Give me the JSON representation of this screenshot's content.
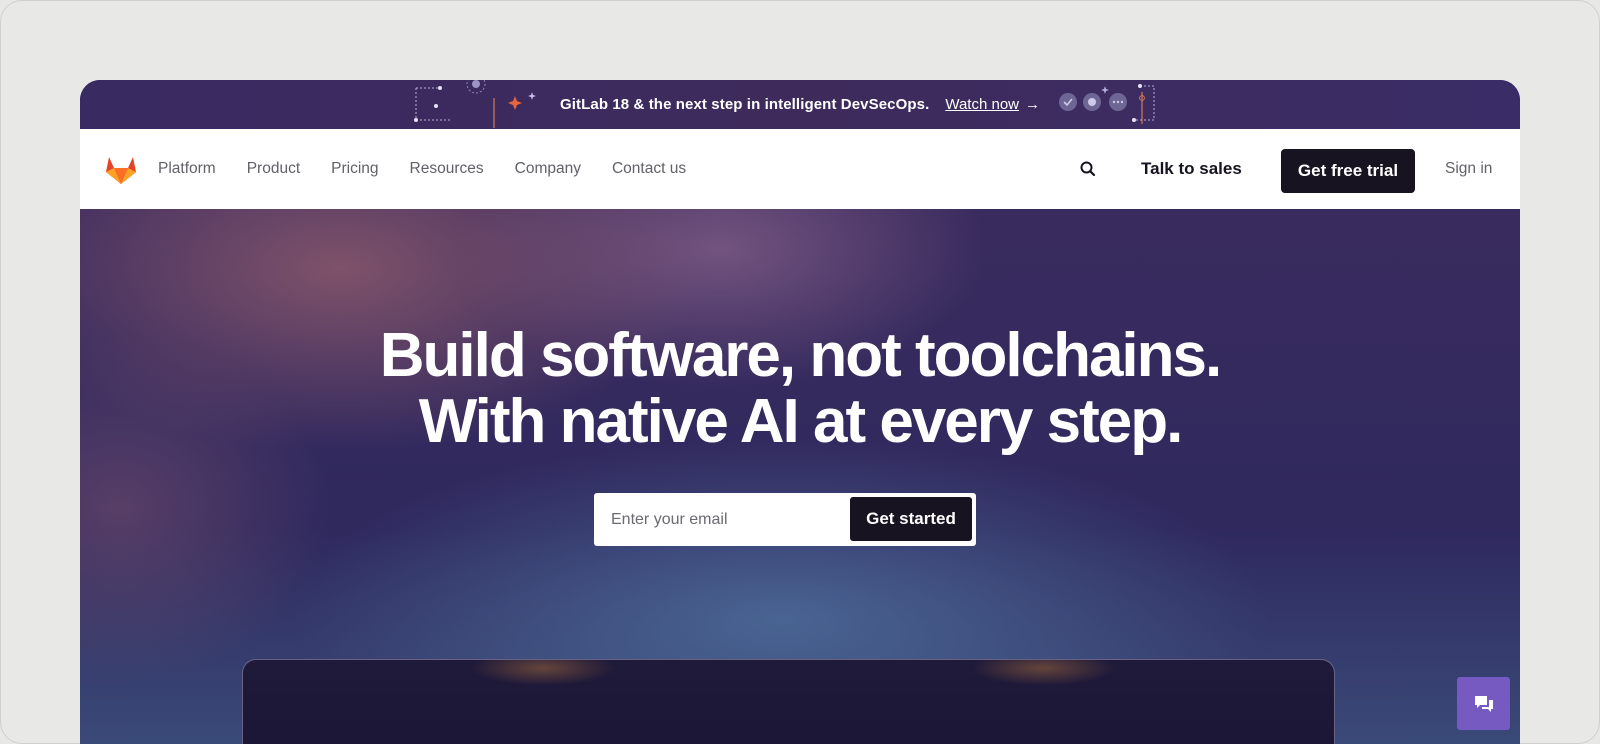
{
  "banner": {
    "text": "GitLab 18 & the next step in intelligent DevSecOps.",
    "link_label": "Watch now",
    "arrow": "→"
  },
  "navbar": {
    "logo_icon": "gitlab-tanuki-icon",
    "links": [
      "Platform",
      "Product",
      "Pricing",
      "Resources",
      "Company",
      "Contact us"
    ],
    "search_icon": "search-icon",
    "talk_to_sales": "Talk to sales",
    "free_trial": "Get free trial",
    "sign_in": "Sign in"
  },
  "hero": {
    "title_line1": "Build software, not toolchains.",
    "title_line2": "With native AI at every step.",
    "email_placeholder": "Enter your email",
    "cta": "Get started"
  },
  "chat": {
    "icon": "chat-bubbles-icon"
  },
  "colors": {
    "brand_dark": "#171321",
    "accent_orange": "#e2432a",
    "chat_purple": "#7759c2",
    "banner_bg": "#3a2a62"
  }
}
